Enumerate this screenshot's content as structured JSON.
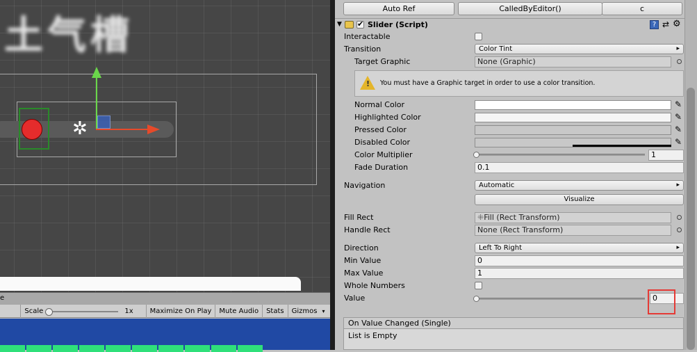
{
  "scene": {
    "title_text": "土气槽",
    "move_tool_icon": "move-tool-icon"
  },
  "game_bar": {
    "tab_fragment": "e",
    "scale_label": "Scale",
    "scale_value": "1x",
    "maximize_label": "Maximize On Play",
    "mute_label": "Mute Audio",
    "stats_label": "Stats",
    "gizmos_label": "Gizmos"
  },
  "top_buttons": {
    "auto_ref": "Auto Ref",
    "called_by_editor": "CalledByEditor()",
    "c": "c"
  },
  "component": {
    "title": "Slider (Script)",
    "enabled": true,
    "icons": [
      "book-icon",
      "preset-icon",
      "gear-icon"
    ]
  },
  "props": {
    "interactable_label": "Interactable",
    "interactable_checked": false,
    "transition_label": "Transition",
    "transition_value": "Color Tint",
    "target_graphic_label": "Target Graphic",
    "target_graphic_value": "None (Graphic)",
    "warning_text": "You must have a Graphic target in order to use a color transition.",
    "normal_color_label": "Normal Color",
    "highlighted_color_label": "Highlighted Color",
    "pressed_color_label": "Pressed Color",
    "disabled_color_label": "Disabled Color",
    "normal_color": "#ffffff",
    "highlighted_color": "#f5f5f5",
    "pressed_color": "#c8c8c8",
    "disabled_color": "#c8c8c8",
    "color_multiplier_label": "Color Multiplier",
    "color_multiplier_value": "1",
    "fade_duration_label": "Fade Duration",
    "fade_duration_value": "0.1",
    "navigation_label": "Navigation",
    "navigation_value": "Automatic",
    "visualize_label": "Visualize",
    "fill_rect_label": "Fill Rect",
    "fill_rect_value": "Fill (Rect Transform)",
    "handle_rect_label": "Handle Rect",
    "handle_rect_value": "None (Rect Transform)",
    "direction_label": "Direction",
    "direction_value": "Left To Right",
    "min_value_label": "Min Value",
    "min_value": "0",
    "max_value_label": "Max Value",
    "max_value": "1",
    "whole_numbers_label": "Whole Numbers",
    "whole_numbers_checked": false,
    "value_label": "Value",
    "value": "0",
    "on_value_changed_label": "On Value Changed (Single)",
    "list_empty_label": "List is Empty"
  },
  "highlight_color": "#e53935"
}
